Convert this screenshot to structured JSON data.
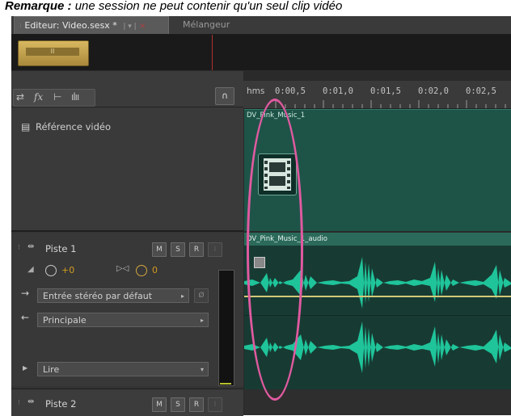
{
  "caption": {
    "bold": "Remarque :",
    "text": " une session ne peut contenir qu'un seul clip vidéo"
  },
  "tabs": {
    "editor": "Editeur: Video.sesx *",
    "mixer": "Mélangeur"
  },
  "overview": {
    "clip_label": "II"
  },
  "toolbar": {
    "fx": "fx",
    "headphone": "∩"
  },
  "ruler": {
    "unit": "hms",
    "labels": [
      "0:00,5",
      "0:01,0",
      "0:01,5",
      "0:02,0",
      "0:02,5"
    ]
  },
  "video_track": {
    "label": "Référence vidéo",
    "clip_name": "DV_Pink_Music_1"
  },
  "track1": {
    "name": "Piste 1",
    "m": "M",
    "s": "S",
    "r": "R",
    "volume": "+0",
    "pan": "0",
    "input": "Entrée stéréo par défaut",
    "output": "Principale",
    "mode": "Lire",
    "clip_name": "DV_Pink_Music_1_audio"
  },
  "track2": {
    "name": "Piste 2",
    "m": "M",
    "s": "S",
    "r": "R"
  },
  "colors": {
    "waveform": "#1fc49a",
    "highlight": "#e05aa0",
    "gold": "#d49a20"
  }
}
